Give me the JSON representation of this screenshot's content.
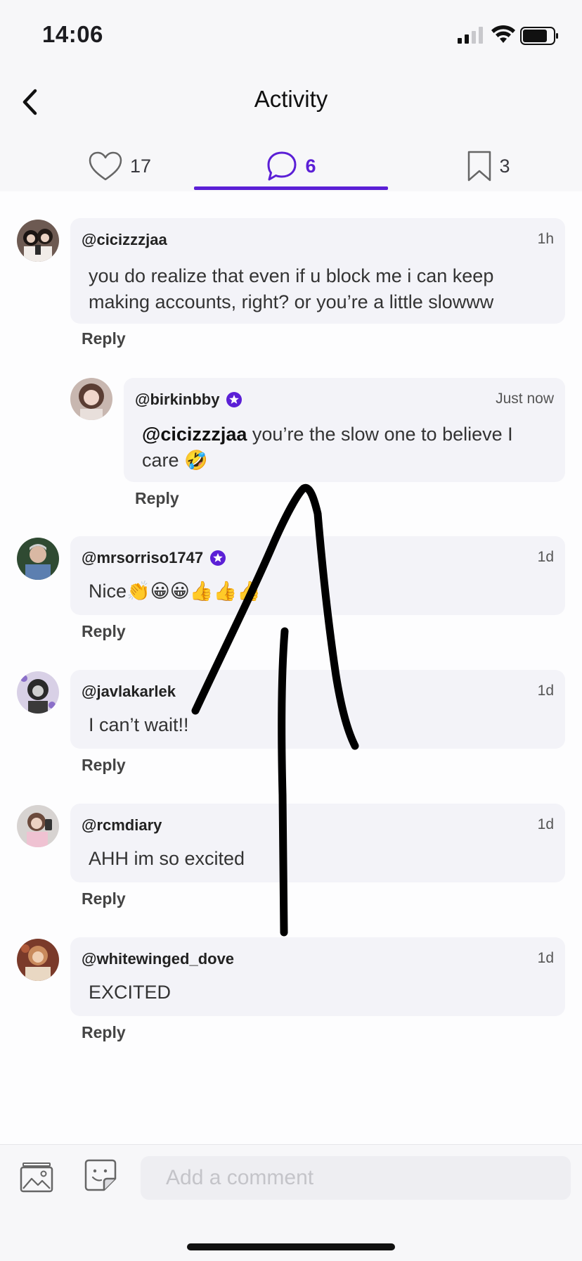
{
  "status_bar": {
    "time": "14:06"
  },
  "header": {
    "title": "Activity"
  },
  "tabs": [
    {
      "name": "likes",
      "count": "17",
      "active": false
    },
    {
      "name": "comments",
      "count": "6",
      "active": true
    },
    {
      "name": "saves",
      "count": "3",
      "active": false
    }
  ],
  "colors": {
    "accent": "#5b1fd6",
    "bubble": "#f3f3f8",
    "bar": "#f7f7f9"
  },
  "comments": [
    {
      "username": "@cicizzzjaa",
      "time": "1h",
      "text_line1": "you do realize that even if u block me i can keep",
      "text_line2": "making accounts, right? or you’re a little slowww",
      "reply": "Reply",
      "verified": false
    },
    {
      "username": "@birkinbby",
      "time": "Just now",
      "mention": "@cicizzzjaa",
      "text_line1": " you’re the slow one to believe I",
      "text_line2": "care 🤣",
      "reply": "Reply",
      "verified": true,
      "is_reply": true
    },
    {
      "username": "@mrsorriso1747",
      "time": "1d",
      "text": "Nice👏😀😀👍👍👍",
      "reply": "Reply",
      "verified": true
    },
    {
      "username": "@javlakarlek",
      "time": "1d",
      "text": "I can’t wait!!",
      "reply": "Reply",
      "verified": false
    },
    {
      "username": "@rcmdiary",
      "time": "1d",
      "text": "AHH im so excited",
      "reply": "Reply",
      "verified": false
    },
    {
      "username": "@whitewinged_dove",
      "time": "1d",
      "text": "EXCITED",
      "reply": "Reply",
      "verified": false
    }
  ],
  "composer": {
    "placeholder": "Add a comment"
  },
  "icons": {
    "back": "chevron-left-icon",
    "likes": "heart-icon",
    "comments": "speech-bubble-icon",
    "saves": "bookmark-icon",
    "image": "image-icon",
    "sticker": "sticker-icon",
    "verified": "verified-star-badge-icon"
  }
}
